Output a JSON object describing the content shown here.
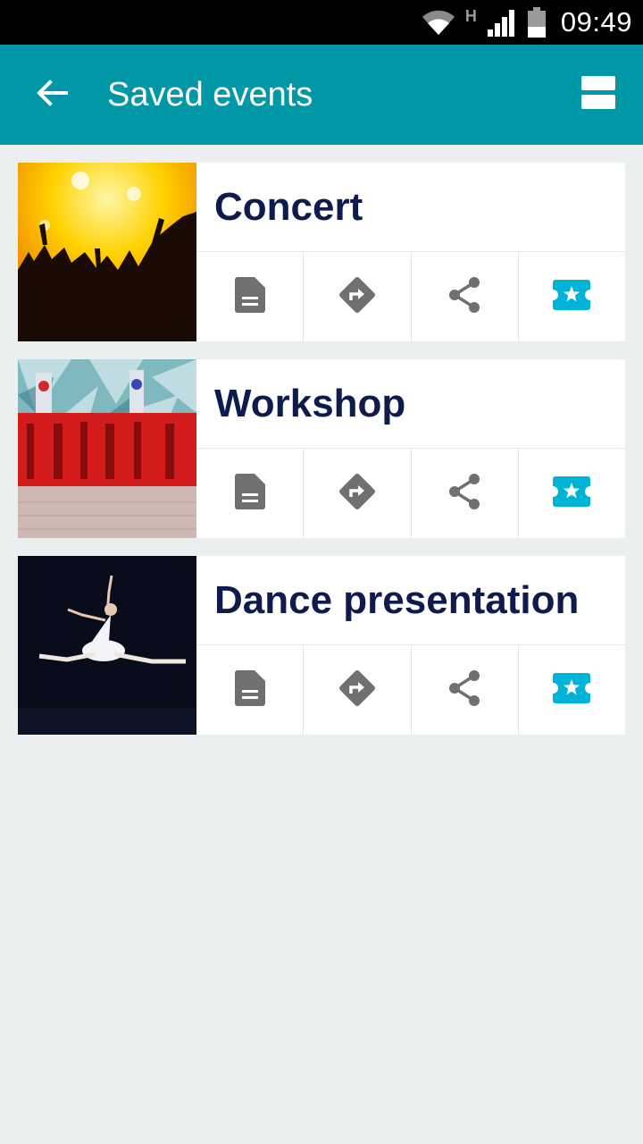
{
  "status_bar": {
    "network_type": "H",
    "time": "09:49"
  },
  "app_bar": {
    "title": "Saved events",
    "back_icon": "arrow-left-icon",
    "view_toggle_icon": "view-agenda-icon"
  },
  "events": [
    {
      "title": "Concert",
      "image": "concert crowd with stage lights"
    },
    {
      "title": "Workshop",
      "image": "red letter sculptures with flags"
    },
    {
      "title": "Dance presentation",
      "image": "ballet dancer mid-leap"
    }
  ],
  "actions": [
    {
      "name": "details",
      "icon": "document-icon"
    },
    {
      "name": "directions",
      "icon": "directions-icon"
    },
    {
      "name": "share",
      "icon": "share-icon"
    },
    {
      "name": "tickets",
      "icon": "ticket-star-icon"
    }
  ],
  "colors": {
    "app_bar": "#0097a7",
    "background": "#ebeff0",
    "title_text": "#0d1b4d",
    "icon_gray": "#707070",
    "ticket_accent": "#00b4d8"
  }
}
